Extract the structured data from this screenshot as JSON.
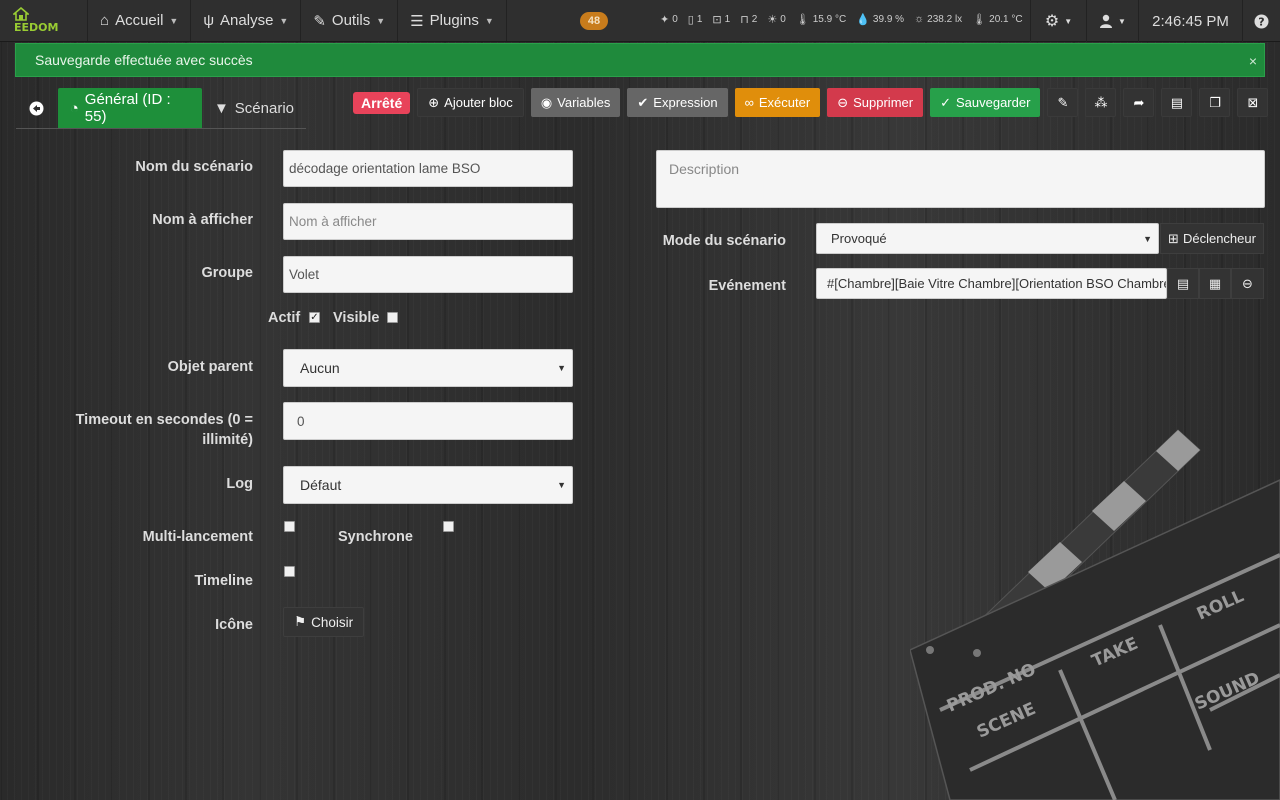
{
  "navbar": {
    "logo_text": "EEDOM",
    "menu": [
      {
        "label": "Accueil",
        "icon": "home-icon",
        "glyph": "⌂"
      },
      {
        "label": "Analyse",
        "icon": "stethoscope-icon",
        "glyph": "ψ"
      },
      {
        "label": "Outils",
        "icon": "wrench-icon",
        "glyph": "✎"
      },
      {
        "label": "Plugins",
        "icon": "tasks-icon",
        "glyph": "☰"
      }
    ],
    "message_count": "48",
    "summary": [
      {
        "icon": "motion-icon",
        "glyph": "✦",
        "value": "0"
      },
      {
        "icon": "door-icon",
        "glyph": "▯",
        "value": "1"
      },
      {
        "icon": "window-icon",
        "glyph": "⊡",
        "value": "1"
      },
      {
        "icon": "shutter-icon",
        "glyph": "⊓",
        "value": "2"
      },
      {
        "icon": "light-icon",
        "glyph": "☀",
        "value": "0"
      },
      {
        "icon": "thermometer-icon",
        "glyph": "🌡",
        "value": "15.9 °C"
      },
      {
        "icon": "humidity-icon",
        "glyph": "💧",
        "value": "39.9 %"
      },
      {
        "icon": "luminosity-icon",
        "glyph": "☼",
        "value": "238.2 lx"
      },
      {
        "icon": "thermometer-icon",
        "glyph": "🌡",
        "value": "20.1 °C"
      }
    ],
    "time": "2:46:45 PM"
  },
  "alert": {
    "message": "Sauvegarde effectuée avec succès",
    "close": "×"
  },
  "tabs": {
    "general": "Général (ID : 55)",
    "scenario": "Scénario"
  },
  "toolbar": {
    "status": "Arrêté",
    "add_block": "Ajouter bloc",
    "variables": "Variables",
    "expression": "Expression",
    "execute": "Exécuter",
    "delete": "Supprimer",
    "save": "Sauvegarder"
  },
  "form": {
    "name_label": "Nom du scénario",
    "name_value": "décodage orientation lame BSO",
    "display_label": "Nom à afficher",
    "display_placeholder": "Nom à afficher",
    "group_label": "Groupe",
    "group_value": "Volet",
    "active_label": "Actif",
    "active_checked": true,
    "visible_label": "Visible",
    "visible_checked": false,
    "parent_label": "Objet parent",
    "parent_value": "Aucun",
    "timeout_label_1": "Timeout en secondes (0 =",
    "timeout_label_2": "illimité)",
    "timeout_value": "0",
    "log_label": "Log",
    "log_value": "Défaut",
    "multi_label": "Multi-lancement",
    "multi_checked": false,
    "sync_label": "Synchrone",
    "sync_checked": false,
    "timeline_label": "Timeline",
    "timeline_checked": false,
    "icon_label": "Icône",
    "choose_button": "Choisir",
    "description_placeholder": "Description",
    "mode_label": "Mode du scénario",
    "mode_value": "Provoqué",
    "trigger_button": "Déclencheur",
    "event_label": "Evénement",
    "event_value": "#[Chambre][Baie Vitre Chambre][Orientation BSO Chambre]#"
  },
  "clapper_text": [
    "PROD. NO",
    "SCENE",
    "TAKE",
    "ROLL",
    "SOUND"
  ],
  "colors": {
    "accent_green": "#27a04a",
    "danger_red": "#d33a4c",
    "warning_orange": "#e08e0b",
    "status_red": "#e8435a"
  }
}
